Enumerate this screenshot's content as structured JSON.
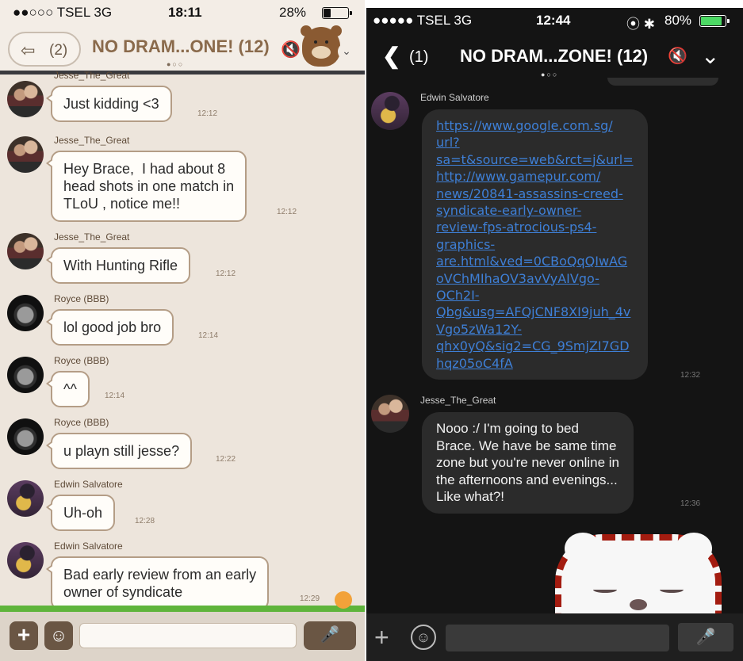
{
  "left": {
    "status": {
      "carrier": "●●○○○ TSEL  3G",
      "time": "18:11",
      "battery": "28%",
      "battery_level": 0.28
    },
    "nav": {
      "back_arrow": "⇦",
      "back_count": "(2)",
      "title": "NO DRAM...ONE! (12)",
      "mute_icon": "🔇",
      "chevron": "⌄"
    },
    "messages": [
      {
        "sender": "Jesse_The_Great",
        "avatar": "couple",
        "text": "Just kidding <3",
        "time": "12:12"
      },
      {
        "sender": "Jesse_The_Great",
        "avatar": "couple",
        "text": "Hey Brace,  I had about 8\nhead shots in one match in\nTLoU , notice me!!",
        "time": "12:12"
      },
      {
        "sender": "Jesse_The_Great",
        "avatar": "couple",
        "text": "With Hunting Rifle",
        "time": "12:12"
      },
      {
        "sender": "Royce (BBB)",
        "avatar": "royce",
        "text": "lol good job bro",
        "time": "12:14"
      },
      {
        "sender": "Royce (BBB)",
        "avatar": "royce",
        "text": "^^",
        "time": "12:14"
      },
      {
        "sender": "Royce (BBB)",
        "avatar": "royce",
        "text": "u playn still jesse?",
        "time": "12:22"
      },
      {
        "sender": "Edwin Salvatore",
        "avatar": "edwin",
        "text": "Uh-oh",
        "time": "12:28"
      },
      {
        "sender": "Edwin Salvatore",
        "avatar": "edwin",
        "text": "Bad early review from an early\nowner of syndicate",
        "time": "12:29"
      }
    ],
    "input": {
      "plus": "+",
      "emoji": "☺",
      "mic": "🎤",
      "placeholder": ""
    }
  },
  "right": {
    "status": {
      "carrier": "●●●●● TSEL  3G",
      "time": "12:44",
      "icons": "⦿ ✱",
      "battery": "80%",
      "battery_level": 0.8
    },
    "nav": {
      "back_arrow": "❮",
      "back_count": "(1)",
      "title": "NO DRAM...ZONE! (12)",
      "mute_icon": "🔇",
      "chevron": "⌄"
    },
    "messages": [
      {
        "sender": "Edwin Salvatore",
        "avatar": "edwin",
        "text": "https://www.google.com.sg/\nurl?\nsa=t&source=web&rct=j&url=\nhttp://www.gamepur.com/\nnews/20841-assassins-creed-\nsyndicate-early-owner-\nreview-fps-atrocious-ps4-\ngraphics-\nare.html&ved=0CBoQqQIwAG\noVChMIhaOV3avVyAIVgo-\nOCh2I-\nQbg&usg=AFQjCNF8XI9juh_4v\nVgo5zWa12Y-\nqhx0yQ&sig2=CG_9SmjZI7GD\nhqz05oC4fA",
        "time": "12:32"
      },
      {
        "sender": "Jesse_The_Great",
        "avatar": "couple",
        "text": "Nooo :/ I'm going to bed\nBrace. We have be same time\nzone but you're never online in\nthe afternoons and evenings...\nLike what?!",
        "time": "12:36"
      }
    ],
    "input": {
      "plus": "+",
      "emoji": "☺",
      "mic": "🎤",
      "placeholder": ""
    }
  },
  "colors": {
    "left_bg": "#ede5dc",
    "right_bg": "#141414",
    "link": "#3e7fd6",
    "bubble_border": "#b49d86"
  }
}
